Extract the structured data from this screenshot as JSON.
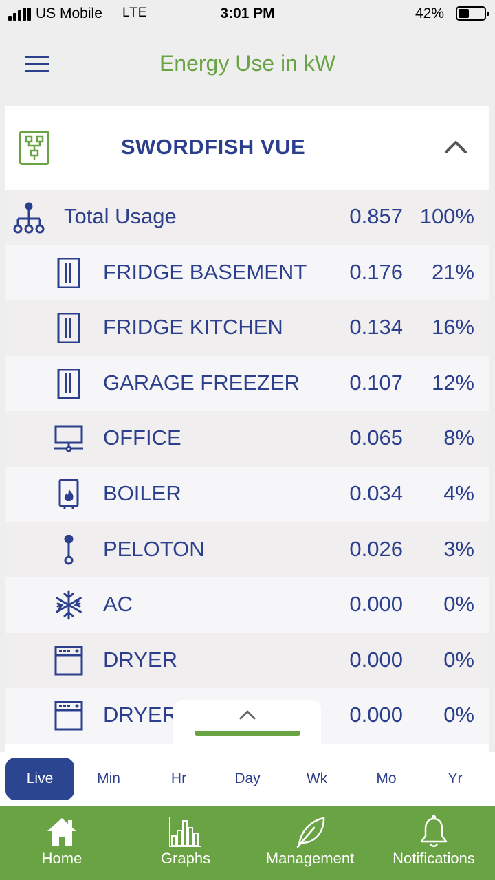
{
  "status_bar": {
    "carrier": "US Mobile",
    "network": "LTE",
    "time": "3:01 PM",
    "battery": "42%",
    "battery_level": 0.42
  },
  "header": {
    "title": "Energy Use in kW",
    "menu_icon": "hamburger-menu-icon"
  },
  "device": {
    "name": "SWORDFISH VUE",
    "icon": "panel-icon",
    "state": "expanded"
  },
  "circuits": [
    {
      "name": "Total Usage",
      "kw": "0.857",
      "pct": "100%",
      "icon": "circuit-tree-icon"
    },
    {
      "name": "FRIDGE BASEMENT",
      "kw": "0.176",
      "pct": "21%",
      "icon": "fridge-icon"
    },
    {
      "name": "FRIDGE KITCHEN",
      "kw": "0.134",
      "pct": "16%",
      "icon": "fridge-icon"
    },
    {
      "name": "GARAGE FREEZER",
      "kw": "0.107",
      "pct": "12%",
      "icon": "fridge-icon"
    },
    {
      "name": "OFFICE",
      "kw": "0.065",
      "pct": "8%",
      "icon": "computer-icon"
    },
    {
      "name": "BOILER",
      "kw": "0.034",
      "pct": "4%",
      "icon": "boiler-icon"
    },
    {
      "name": "PELOTON",
      "kw": "0.026",
      "pct": "3%",
      "icon": "plug-icon"
    },
    {
      "name": "AC",
      "kw": "0.000",
      "pct": "0%",
      "icon": "snowflake-icon"
    },
    {
      "name": "DRYER",
      "kw": "0.000",
      "pct": "0%",
      "icon": "dryer-icon"
    },
    {
      "name": "DRYER",
      "kw": "0.000",
      "pct": "0%",
      "icon": "dryer-icon"
    }
  ],
  "time_tabs": [
    "Live",
    "Min",
    "Hr",
    "Day",
    "Wk",
    "Mo",
    "Yr"
  ],
  "active_time_tab": "Live",
  "bottom_nav": [
    {
      "label": "Home",
      "icon": "home-icon"
    },
    {
      "label": "Graphs",
      "icon": "bar-chart-icon"
    },
    {
      "label": "Management",
      "icon": "leaf-icon"
    },
    {
      "label": "Notifications",
      "icon": "bell-icon"
    }
  ],
  "colors": {
    "accent_green": "#6aa343",
    "primary_blue": "#2b3f8c",
    "active_tab": "#2b4591"
  }
}
